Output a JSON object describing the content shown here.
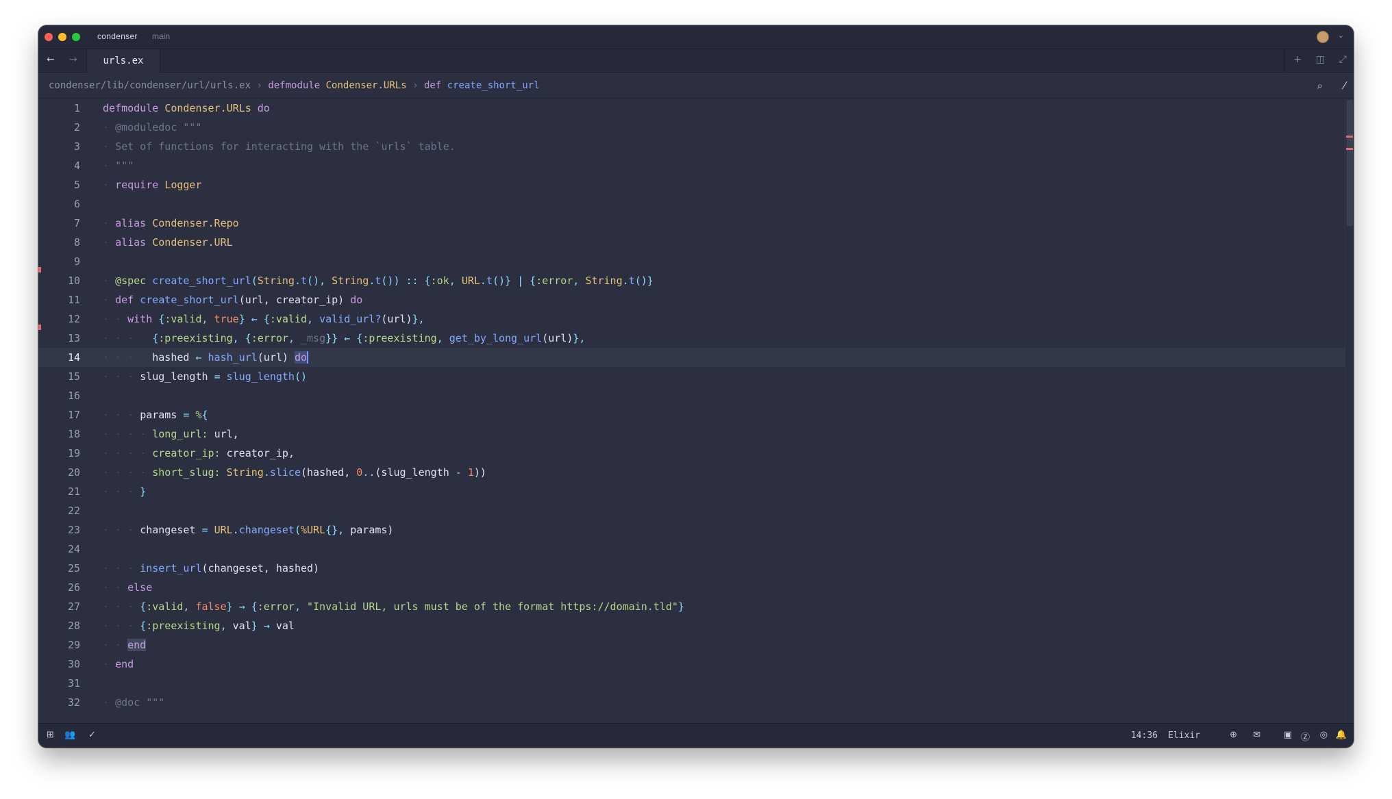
{
  "titlebar": {
    "project": "condenser",
    "branch": "main",
    "avatar_icon": "user-avatar-icon"
  },
  "tabs": [
    {
      "label": "urls.ex",
      "active": true
    }
  ],
  "breadcrumb": {
    "path": "condenser/lib/condenser/url/urls.ex",
    "separator": "›",
    "module_keyword": "defmodule",
    "module_name": "Condenser.URLs",
    "function_keyword": "def",
    "function_name": "create_short_url"
  },
  "editor": {
    "current_line": 14,
    "line_numbers": [
      "1",
      "2",
      "3",
      "4",
      "5",
      "6",
      "7",
      "8",
      "9",
      "10",
      "11",
      "12",
      "13",
      "14",
      "15",
      "16",
      "17",
      "18",
      "19",
      "20",
      "21",
      "22",
      "23",
      "24",
      "25",
      "26",
      "27",
      "28",
      "29",
      "30",
      "31",
      "32"
    ],
    "lines": [
      "defmodule Condenser.URLs do",
      "  @moduledoc \"\"\"",
      "  Set of functions for interacting with the `urls` table.",
      "  \"\"\"",
      "  require Logger",
      "",
      "  alias Condenser.Repo",
      "  alias Condenser.URL",
      "",
      "  @spec create_short_url(String.t(), String.t()) :: {:ok, URL.t()} | {:error, String.t()}",
      "  def create_short_url(url, creator_ip) do",
      "    with {:valid, true} <- {:valid, valid_url?(url)},",
      "         {:preexisting, {:error, _msg}} <- {:preexisting, get_by_long_url(url)},",
      "         hashed <- hash_url(url) do",
      "      slug_length = slug_length()",
      "",
      "      params = %{",
      "        long_url: url,",
      "        creator_ip: creator_ip,",
      "        short_slug: String.slice(hashed, 0..(slug_length - 1))",
      "      }",
      "",
      "      changeset = URL.changeset(%URL{}, params)",
      "",
      "      insert_url(changeset, hashed)",
      "    else",
      "      {:valid, false} -> {:error, \"Invalid URL, urls must be of the format https://domain.tld\"}",
      "      {:preexisting, val} -> val",
      "    end",
      "  end",
      "",
      "  @doc \"\"\""
    ]
  },
  "status": {
    "cursor_position": "14:36",
    "language": "Elixir"
  },
  "colors": {
    "background": "#2b2f40",
    "chrome": "#25293a",
    "keyword": "#c99be0",
    "module": "#e5c07b",
    "function": "#82aaff",
    "atom": "#b5d98a",
    "number": "#f78c6c",
    "comment": "#6f7489",
    "marker": "#e06c75"
  }
}
